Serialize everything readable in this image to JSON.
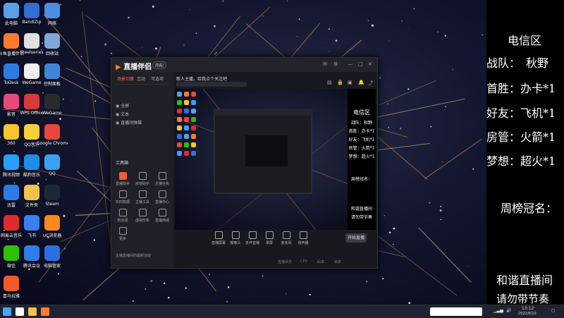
{
  "colors": {
    "accent": "#ff6b3a",
    "panel_bg": "#000000",
    "text": "#ffffff"
  },
  "desktop_icons": [
    {
      "label": "此电脑",
      "color": "#5aa0e6"
    },
    {
      "label": "BandiZip",
      "color": "#2f6fd6"
    },
    {
      "label": "网络",
      "color": "#4a8fe0"
    },
    {
      "label": "斗鱼直播伴侣",
      "color": "#ff7a2f"
    },
    {
      "label": "Steelseries",
      "color": "#e0e0e0"
    },
    {
      "label": "回收站",
      "color": "#7fa7d8"
    },
    {
      "label": "ToDesk",
      "color": "#2a7de1"
    },
    {
      "label": "WeGame",
      "color": "#f0f0f0"
    },
    {
      "label": "控制面板",
      "color": "#3f86d6"
    },
    {
      "label": "影音",
      "color": "#e84a7a"
    },
    {
      "label": "WPS Office",
      "color": "#d83a3a"
    },
    {
      "label": "WeGame",
      "color": "#2a2a2a"
    },
    {
      "label": "360",
      "color": "#f7c531"
    },
    {
      "label": "QQ音乐",
      "color": "#f5d23a"
    },
    {
      "label": "Google Chrome",
      "color": "#e8473b"
    },
    {
      "label": "腾讯视频",
      "color": "#27a0ff"
    },
    {
      "label": "酷狗音乐",
      "color": "#1e8ee8"
    },
    {
      "label": "QQ",
      "color": "#38a1f3"
    },
    {
      "label": "迅雷",
      "color": "#2d7be5"
    },
    {
      "label": "文件夹",
      "color": "#f2c14e"
    },
    {
      "label": "Steam",
      "color": "#1b2838"
    },
    {
      "label": "网易云音乐",
      "color": "#e12b2b"
    },
    {
      "label": "飞书",
      "color": "#3b7ff5"
    },
    {
      "label": "UC浏览器",
      "color": "#ff8a1a"
    },
    {
      "label": "微信",
      "color": "#2dc100"
    },
    {
      "label": "腾讯会议",
      "color": "#2f7ee8"
    },
    {
      "label": "电脑管家",
      "color": "#2c6fe0"
    },
    {
      "label": "喜马拉雅",
      "color": "#f05a28"
    }
  ],
  "app": {
    "logo": "直播伴侣",
    "version": "简配",
    "side_tabs": [
      "场景切换",
      "互动",
      "可选项"
    ],
    "scene_rows": [
      "全屏",
      "文本",
      "直播间弹幕"
    ],
    "tools_title": "工具箱",
    "tools": [
      "直播助手",
      "房管助手",
      "主播任务",
      "实时数据",
      "主播工具",
      "直播中心",
      "粉丝团",
      "虚拟形象",
      "直播商城",
      "更多"
    ],
    "notice": "主播直播间的最新活动",
    "stream_title": "新人主播，给我点个关注吧",
    "bottom_buttons": [
      "直播屏幕",
      "摄像头",
      "多开直播",
      "录屏",
      "麦克风",
      "扬声器"
    ],
    "start_button": "开始直播",
    "status": [
      "直播状态",
      "CPU",
      "码率",
      "帧率"
    ]
  },
  "panel": {
    "region": "电信区",
    "team_label": "战队：",
    "team": "秋野",
    "first_win_label": "首胜：",
    "first_win": "办卡*1",
    "friend_label": "好友：",
    "friend": "飞机*1",
    "room_label": "房管：",
    "room": "火箭*1",
    "dream_label": "梦想：",
    "dream": "超火*1",
    "weekly_label": "周榜冠名：",
    "footer1": "和谐直播间",
    "footer2": "请勿带节奏"
  },
  "taskbar": {
    "time": "13:12",
    "date": "2022/6/10"
  }
}
